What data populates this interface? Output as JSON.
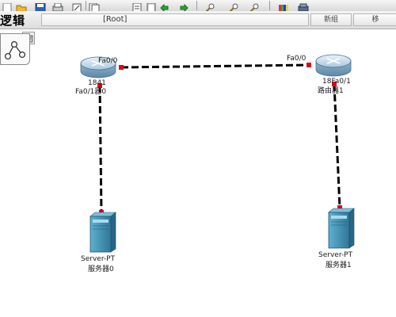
{
  "view": {
    "mode_label": "逻辑",
    "path_label": "[Root]",
    "new_cluster_label": "新组",
    "move_label": "移"
  },
  "devices": {
    "router0": {
      "model": "1841",
      "name": "Fa0/1器0"
    },
    "router1": {
      "model": "18Fa0/1",
      "name": "路由器1"
    },
    "server0": {
      "model": "Server-PT",
      "name": "服务器0"
    },
    "server1": {
      "model": "Server-PT",
      "name": "服务器1"
    }
  },
  "ports": {
    "r0_fa00": "Fa0/0",
    "r1_fa00": "Fa0/0"
  },
  "colors": {
    "link": "#000000",
    "link_endpoint": "#e0001b",
    "router_body": "#9fc3dc",
    "server_body": "#3f8fb4"
  },
  "icons": [
    "new-icon",
    "open-icon",
    "save-icon",
    "print-icon",
    "wizard-icon",
    "copy-icon",
    "paste-icon",
    "undo-icon",
    "redo-icon",
    "zoom-in-icon",
    "zoom-reset-icon",
    "zoom-out-icon",
    "palette-icon",
    "custom-device-icon"
  ]
}
